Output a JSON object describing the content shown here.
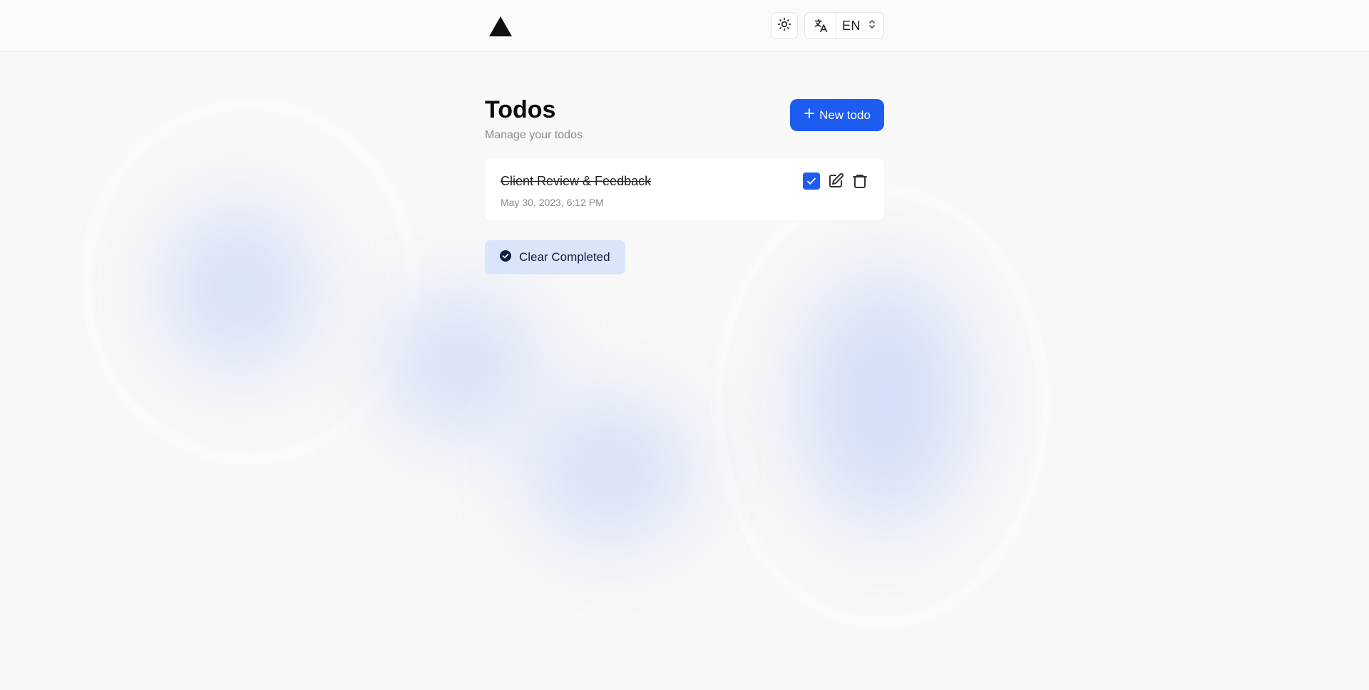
{
  "header": {
    "logo_icon": "triangle-logo-icon",
    "theme_icon": "sun-icon",
    "language_icon": "translate-icon",
    "language_code": "EN",
    "language_chevron_icon": "chevron-up-down-icon"
  },
  "page": {
    "title": "Todos",
    "subtitle": "Manage your todos",
    "new_button_label": "New todo",
    "new_button_icon": "plus-icon"
  },
  "todos": [
    {
      "title": "Client Review & Feedback",
      "date": "May 30, 2023, 6:12 PM",
      "completed": true
    }
  ],
  "actions": {
    "clear_completed_label": "Clear Completed",
    "clear_completed_icon": "check-circle-icon"
  },
  "colors": {
    "accent": "#1d5cf0",
    "clear_bg": "#dbe5fa",
    "page_bg": "#f8f8f8"
  }
}
